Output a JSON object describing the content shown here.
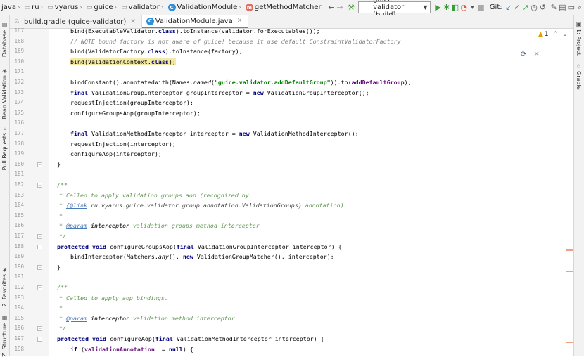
{
  "breadcrumbs": [
    "java",
    "ru",
    "vyarus",
    "guice",
    "validator",
    "ValidationModule",
    "getMethodMatcher"
  ],
  "run_config": "guice-validator [build]",
  "git_label": "Git:",
  "tabs": [
    {
      "label": "build.gradle (guice-validator)",
      "active": false
    },
    {
      "label": "ValidationModule.java",
      "active": true
    }
  ],
  "left_tools": [
    "Database",
    "Bean Validation",
    "Pull Requests",
    "2: Favorites",
    "Z: Structure"
  ],
  "right_tools": [
    "1: Project",
    "Gradle"
  ],
  "inspection": {
    "count": "1"
  },
  "code_lines": [
    {
      "n": "167",
      "t": "bind(ExecutableValidator.class).toInstance(validator.forExecutables());"
    },
    {
      "n": "168",
      "t": "// NOTE bound factory is not aware of guice! because it use default ConstraintValidatorFactory"
    },
    {
      "n": "169",
      "t": "bind(ValidatorFactory.class).toInstance(factory);"
    },
    {
      "n": "170",
      "t": "bind(ValidationContext.class);"
    },
    {
      "n": "171",
      "t": ""
    },
    {
      "n": "172",
      "t": "bindConstant().annotatedWith(Names.named(\"guice.validator.addDefaultGroup\")).to(addDefaultGroup);"
    },
    {
      "n": "173",
      "t": "final ValidationGroupInterceptor groupInterceptor = new ValidationGroupInterceptor();"
    },
    {
      "n": "174",
      "t": "requestInjection(groupInterceptor);"
    },
    {
      "n": "175",
      "t": "configureGroupsAop(groupInterceptor);"
    },
    {
      "n": "176",
      "t": ""
    },
    {
      "n": "177",
      "t": "final ValidationMethodInterceptor interceptor = new ValidationMethodInterceptor();"
    },
    {
      "n": "178",
      "t": "requestInjection(interceptor);"
    },
    {
      "n": "179",
      "t": "configureAop(interceptor);"
    },
    {
      "n": "180",
      "t": "}"
    },
    {
      "n": "181",
      "t": ""
    },
    {
      "n": "182",
      "t": "/**"
    },
    {
      "n": "183",
      "t": "* Called to apply validation groups aop (recognized by"
    },
    {
      "n": "184",
      "t": "* {@link ru.vyarus.guice.validator.group.annotation.ValidationGroups} annotation)."
    },
    {
      "n": "185",
      "t": "*"
    },
    {
      "n": "186",
      "t": "* @param interceptor validation groups method interceptor"
    },
    {
      "n": "187",
      "t": "*/"
    },
    {
      "n": "188",
      "t": "protected void configureGroupsAop(final ValidationGroupInterceptor interceptor) {"
    },
    {
      "n": "189",
      "t": "bindInterceptor(Matchers.any(), new ValidationGroupMatcher(), interceptor);"
    },
    {
      "n": "190",
      "t": "}"
    },
    {
      "n": "191",
      "t": ""
    },
    {
      "n": "192",
      "t": "/**"
    },
    {
      "n": "193",
      "t": "* Called to apply aop bindings."
    },
    {
      "n": "194",
      "t": "*"
    },
    {
      "n": "195",
      "t": "* @param interceptor validation method interceptor"
    },
    {
      "n": "196",
      "t": "*/"
    },
    {
      "n": "197",
      "t": "protected void configureAop(final ValidationMethodInterceptor interceptor) {"
    },
    {
      "n": "198",
      "t": "if (validationAnnotation != null) {"
    }
  ],
  "colors": {
    "keyword": "#000080",
    "comment": "#808080",
    "string": "#008000",
    "javadoc": "#629755",
    "highlight": "#f5eaa3",
    "accent": "#4a88c7"
  }
}
